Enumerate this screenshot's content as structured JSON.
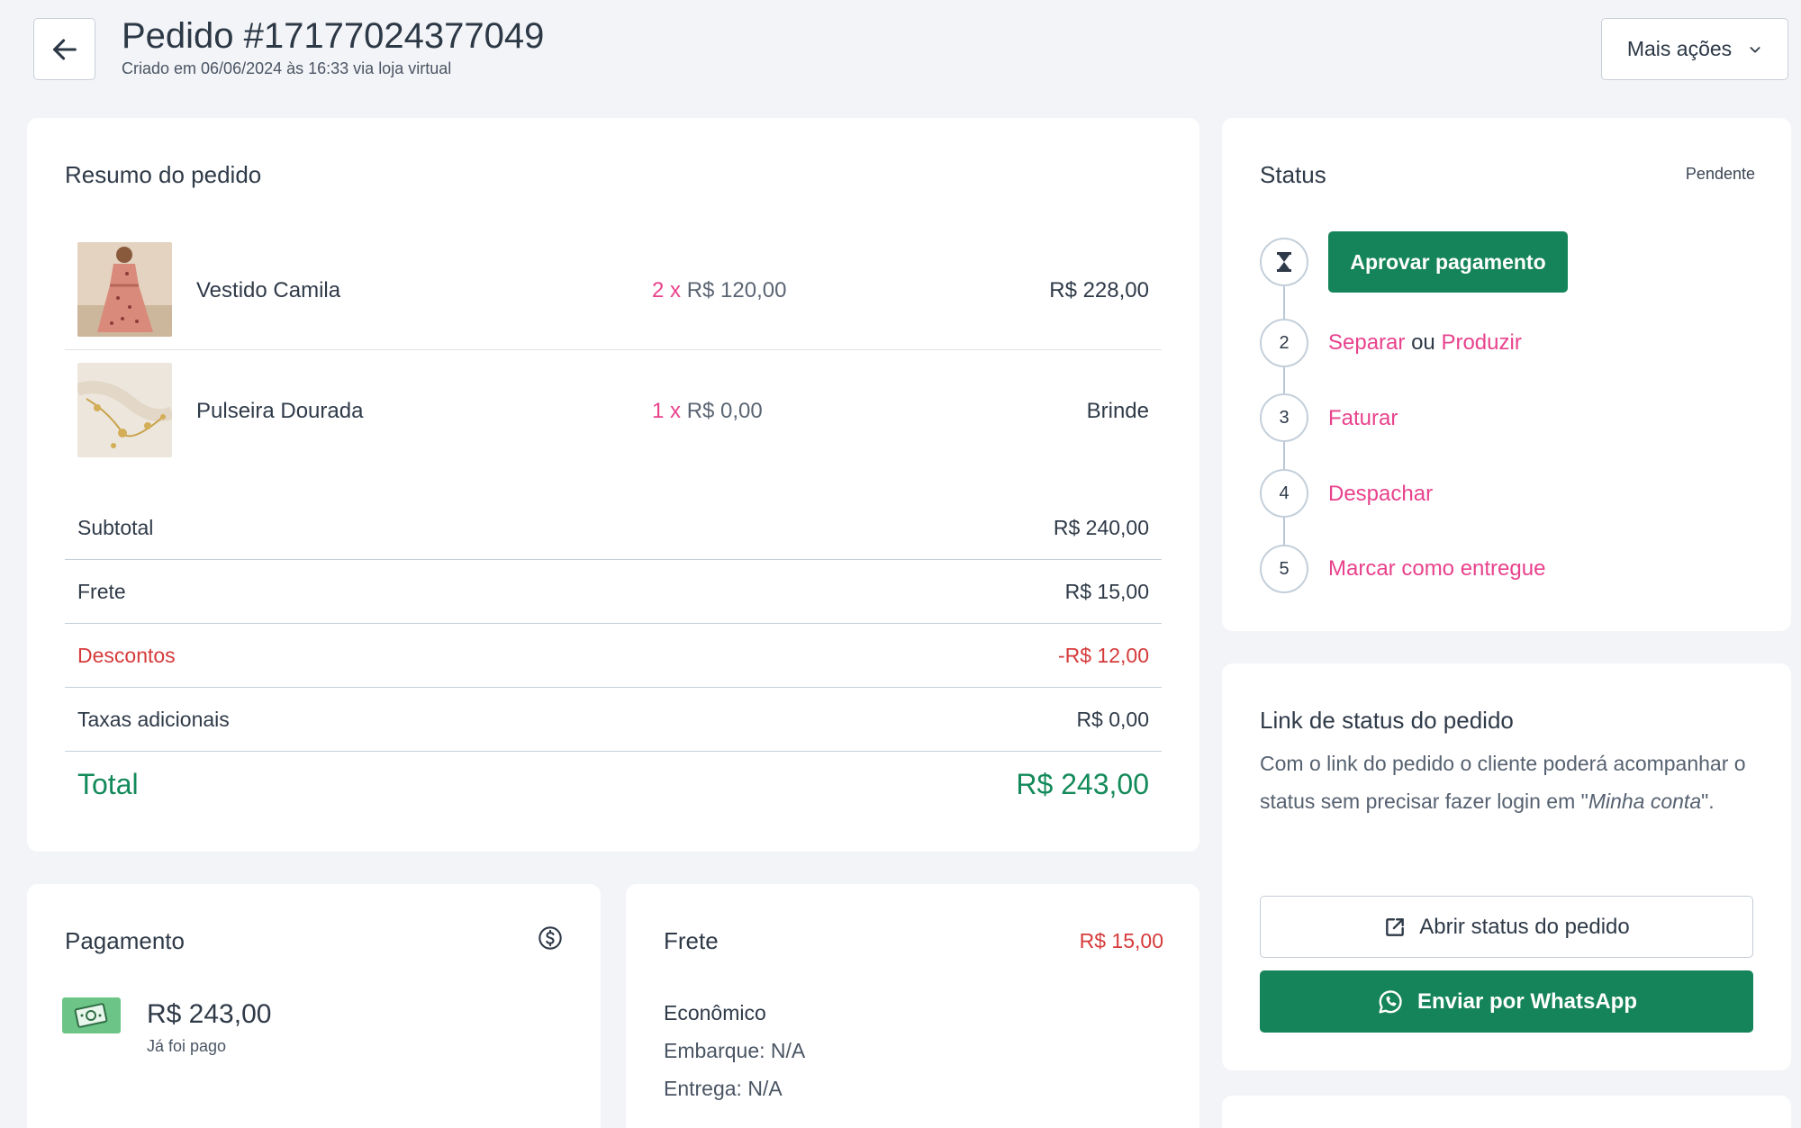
{
  "header": {
    "title": "Pedido #17177024377049",
    "subtitle": "Criado em 06/06/2024 às 16:33 via loja virtual",
    "more_actions_label": "Mais ações"
  },
  "summary": {
    "title": "Resumo do pedido",
    "items": [
      {
        "name": "Vestido Camila",
        "qty": "2 x",
        "unit_price": "R$ 120,00",
        "total": "R$ 228,00"
      },
      {
        "name": "Pulseira Dourada",
        "qty": "1 x",
        "unit_price": "R$ 0,00",
        "total": "Brinde"
      }
    ],
    "rows": {
      "subtotal": {
        "label": "Subtotal",
        "value": "R$ 240,00"
      },
      "frete": {
        "label": "Frete",
        "value": "R$ 15,00"
      },
      "descontos": {
        "label": "Descontos",
        "value": "-R$ 12,00"
      },
      "taxas": {
        "label": "Taxas adicionais",
        "value": "R$ 0,00"
      }
    },
    "total_label": "Total",
    "total_value": "R$ 243,00"
  },
  "status": {
    "title": "Status",
    "badge": "Pendente",
    "approve_label": "Aprovar pagamento",
    "step2_num": "2",
    "step2_a": "Separar",
    "step2_or": "ou",
    "step2_b": "Produzir",
    "step3_num": "3",
    "step3": "Faturar",
    "step4_num": "4",
    "step4": "Despachar",
    "step5_num": "5",
    "step5": "Marcar como entregue"
  },
  "link_card": {
    "title": "Link de status do pedido",
    "desc_before": "Com o link do pedido o cliente poderá acompanhar o status sem precisar fazer login em ",
    "desc_quote_open": "\"",
    "desc_italic": "Minha conta",
    "desc_quote_close": "\".",
    "open_label": "Abrir status do pedido",
    "whatsapp_label": "Enviar por WhatsApp"
  },
  "payment": {
    "title": "Pagamento",
    "amount": "R$ 243,00",
    "status": "Já foi pago"
  },
  "shipping": {
    "title": "Frete",
    "price": "R$ 15,00",
    "method": "Econômico",
    "embarque": "Embarque: N/A",
    "entrega": "Entrega: N/A"
  },
  "colors": {
    "accent_green": "#16845a",
    "link_pink": "#e8428c",
    "discount_red": "#d63b3b",
    "background": "#f3f4f7"
  }
}
